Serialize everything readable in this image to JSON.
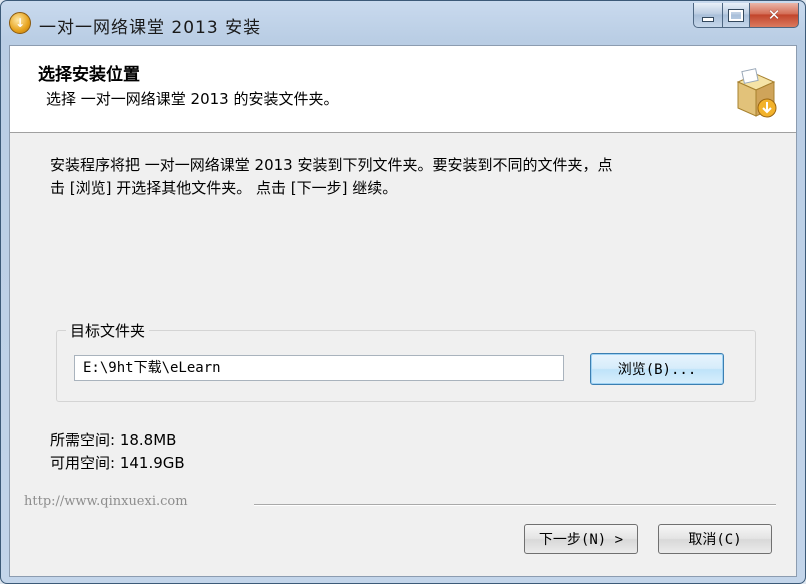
{
  "window": {
    "title": "一对一网络课堂 2013 安装",
    "controls": [
      "minimize",
      "maximize",
      "close"
    ]
  },
  "header": {
    "title": "选择安装位置",
    "subtitle": "选择 一对一网络课堂 2013 的安装文件夹。",
    "icon": "installer-box-icon"
  },
  "intro": {
    "line1": "安装程序将把 一对一网络课堂 2013 安装到下列文件夹。要安装到不同的文件夹，点",
    "line2": "击 [浏览] 开选择其他文件夹。 点击 [下一步] 继续。"
  },
  "destination": {
    "group_label": "目标文件夹",
    "path": "E:\\9ht下载\\eLearn",
    "browse_label": "浏览(B)..."
  },
  "space": {
    "required": "所需空间: 18.8MB",
    "available": "可用空间: 141.9GB"
  },
  "footer": {
    "brand": "http://www.qinxuexi.com",
    "next_label": "下一步(N) >",
    "cancel_label": "取消(C)"
  }
}
